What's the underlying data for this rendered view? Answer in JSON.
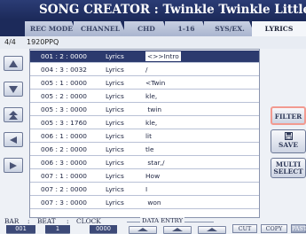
{
  "title": "SONG CREATOR : Twinkle Twinkle Little Star",
  "tabs": [
    {
      "label": "REC MODE"
    },
    {
      "label": "CHANNEL"
    },
    {
      "label": "CHD"
    },
    {
      "label": "1-16"
    },
    {
      "label": "SYS/EX."
    },
    {
      "label": "LYRICS"
    }
  ],
  "active_tab": "LYRICS",
  "info": {
    "time_signature": "4/4",
    "resolution": "1920PPQ"
  },
  "events": [
    {
      "position": "001 : 2 : 0000",
      "type": "Lyrics",
      "text": "<>>Intro"
    },
    {
      "position": "004 : 3 : 0032",
      "type": "Lyrics",
      "text": "/"
    },
    {
      "position": "005 : 1 : 0000",
      "type": "Lyrics",
      "text": "<Twin"
    },
    {
      "position": "005 : 2 : 0000",
      "type": "Lyrics",
      "text": "kle,"
    },
    {
      "position": "005 : 3 : 0000",
      "type": "Lyrics",
      "text": " twin"
    },
    {
      "position": "005 : 3 : 1760",
      "type": "Lyrics",
      "text": "kle,"
    },
    {
      "position": "006 : 1 : 0000",
      "type": "Lyrics",
      "text": "lit"
    },
    {
      "position": "006 : 2 : 0000",
      "type": "Lyrics",
      "text": "tle"
    },
    {
      "position": "006 : 3 : 0000",
      "type": "Lyrics",
      "text": " star,/"
    },
    {
      "position": "007 : 1 : 0000",
      "type": "Lyrics",
      "text": "How"
    },
    {
      "position": "007 : 2 : 0000",
      "type": "Lyrics",
      "text": "I"
    },
    {
      "position": "007 : 3 : 0000",
      "type": "Lyrics",
      "text": " won"
    }
  ],
  "side_buttons": {
    "filter": "FILTER",
    "save": "SAVE",
    "multi_select_line1": "MULTI",
    "multi_select_line2": "SELECT"
  },
  "bottom": {
    "bar_label": "BAR",
    "beat_label": "BEAT",
    "clock_label": "CLOCK",
    "sep1": ":",
    "sep2": ":",
    "bar_value": "001",
    "beat_value": "1",
    "clock_value": "0000",
    "data_entry_label": "DATA ENTRY",
    "cut": "CUT",
    "copy": "COPY",
    "paste": "PASTE"
  },
  "icons": {
    "up": "triangle-up-icon",
    "down": "triangle-down-icon",
    "left": "triangle-left-icon",
    "right": "triangle-right-icon",
    "double_up": "double-triangle-up-icon",
    "save": "disk-icon"
  },
  "colors": {
    "title_bg": "#1c2a5a",
    "selected_row": "#2c3a6e",
    "filter_highlight": "#f29a90"
  }
}
